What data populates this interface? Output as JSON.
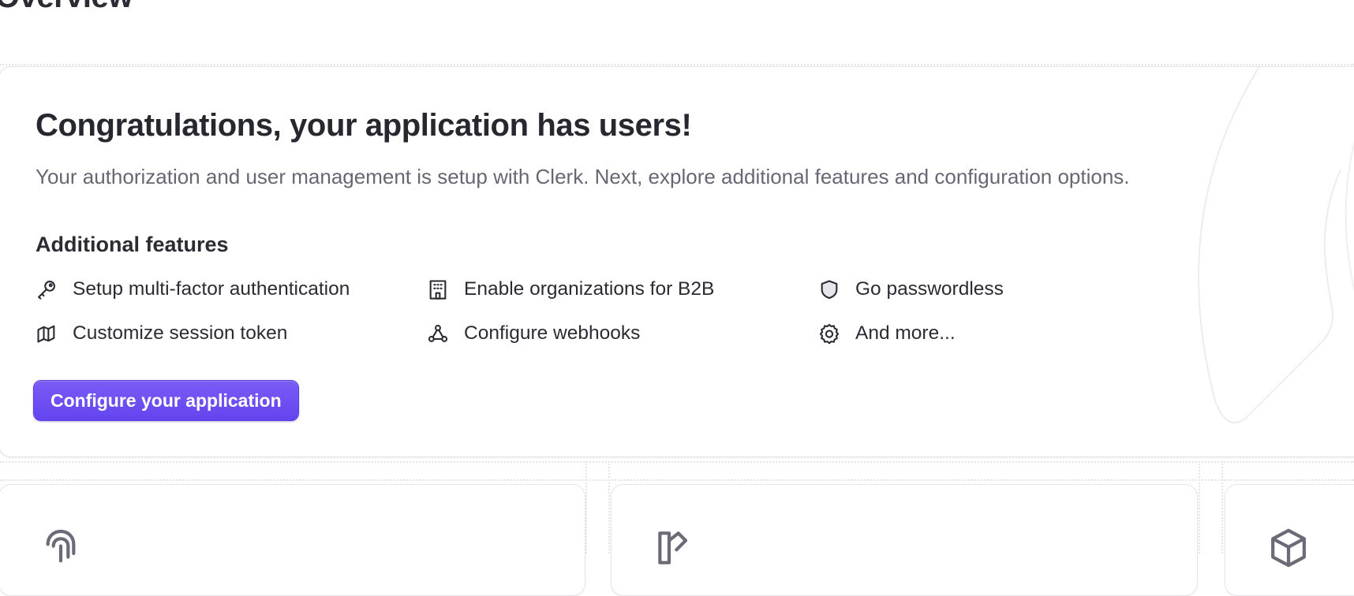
{
  "page": {
    "title": "Overview"
  },
  "hero": {
    "title": "Congratulations, your application has users!",
    "description": "Your authorization and user management is setup with Clerk. Next, explore additional features and configuration options.",
    "features_heading": "Additional features",
    "features": [
      {
        "icon": "key-icon",
        "label": "Setup multi-factor authentication"
      },
      {
        "icon": "building-icon",
        "label": "Enable organizations for B2B"
      },
      {
        "icon": "shield-icon",
        "label": "Go passwordless"
      },
      {
        "icon": "token-icon",
        "label": "Customize session token"
      },
      {
        "icon": "webhook-icon",
        "label": "Configure webhooks"
      },
      {
        "icon": "gear-icon",
        "label": "And more..."
      }
    ],
    "cta_label": "Configure your application"
  },
  "cards": [
    {
      "icon": "fingerprint-icon"
    },
    {
      "icon": "book-pen-icon"
    },
    {
      "icon": "cube-icon"
    }
  ],
  "colors": {
    "accent": "#6c4ef2",
    "text": "#2b2b33",
    "muted": "#676774"
  }
}
